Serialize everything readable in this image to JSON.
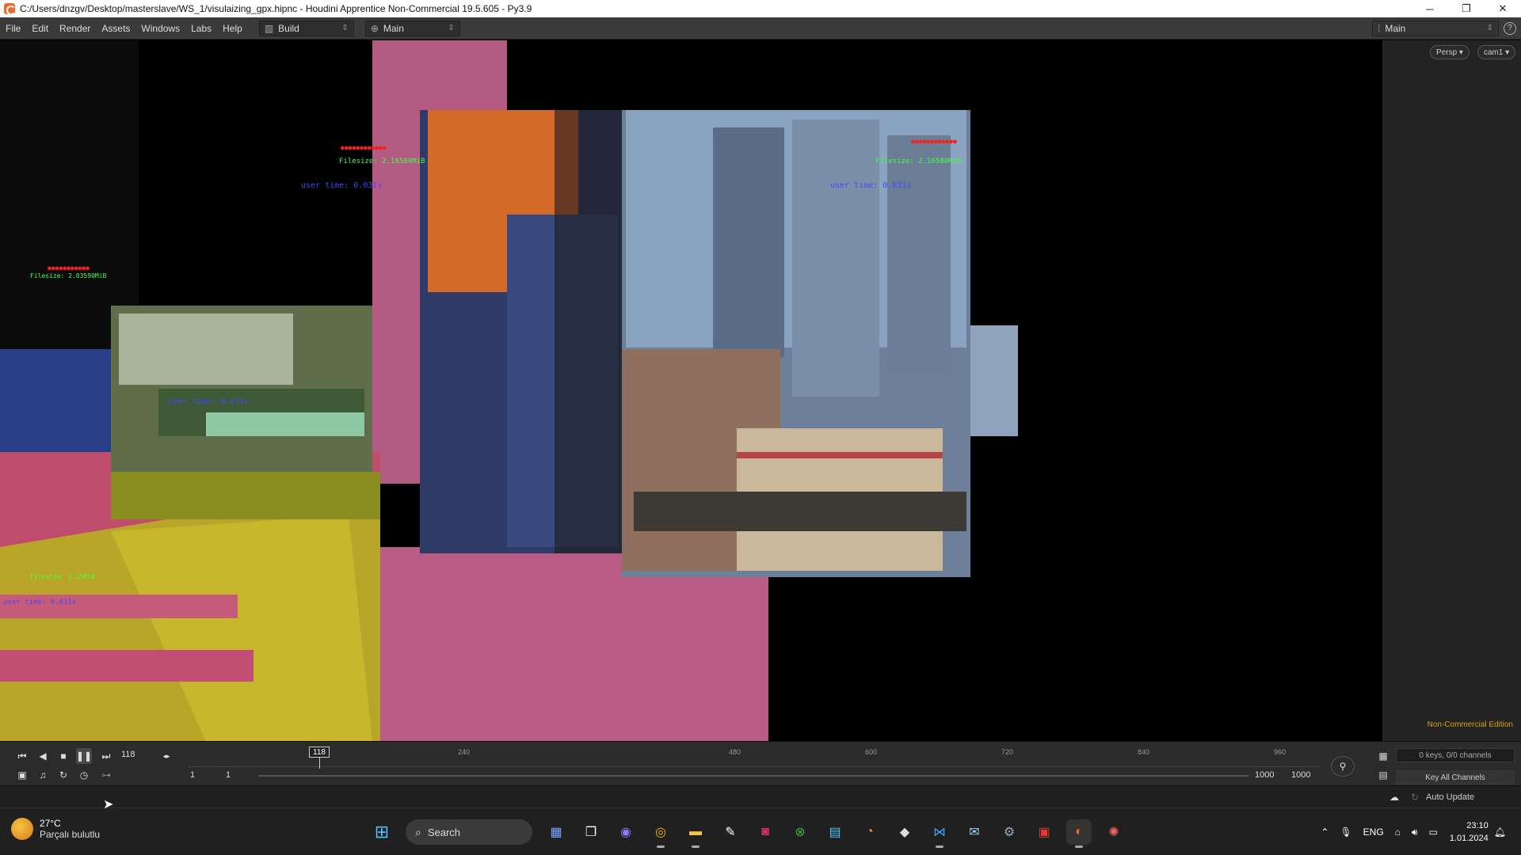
{
  "window": {
    "title": "C:/Users/dnzgv/Desktop/masterslave/WS_1/visulaizing_gpx.hipnc - Houdini Apprentice Non-Commercial 19.5.605 - Py3.9",
    "minimize": "─",
    "restore": "❐",
    "close": "✕"
  },
  "menu": {
    "items": [
      "File",
      "Edit",
      "Render",
      "Assets",
      "Windows",
      "Labs",
      "Help"
    ],
    "desktop_label": "Build",
    "network_label": "Main",
    "main_selector": "Main"
  },
  "viewport": {
    "camera_buttons": [
      "Persp ▾",
      "cam1 ▾"
    ],
    "edition_label": "Non-Commercial Edition",
    "overlay_text": {
      "filesize_main": "Filesize: 2.16580MiB",
      "filesize_left": "Filesize: 2.03590MiB",
      "user_time": "user time: 0.031s",
      "filesize_bottom": "Filesize: 2.15MiB",
      "user_time_bottom": "user time: 0.031s"
    }
  },
  "timeline": {
    "current_frame": "118",
    "cursor_frame": "118",
    "ticks": [
      "240",
      "480",
      "600",
      "720",
      "840",
      "960"
    ],
    "range_start": "1",
    "range_start2": "1",
    "range_end": "1000",
    "range_end2": "1000",
    "keys_info": "0 keys, 0/0 channels",
    "key_all_label": "Key All Channels",
    "auto_update": "Auto Update"
  },
  "taskbar": {
    "temperature": "27°C",
    "weather_desc": "Parçalı bulutlu",
    "search_label": "Search",
    "lang": "ENG",
    "time": "23:10",
    "date": "1.01.2024"
  }
}
